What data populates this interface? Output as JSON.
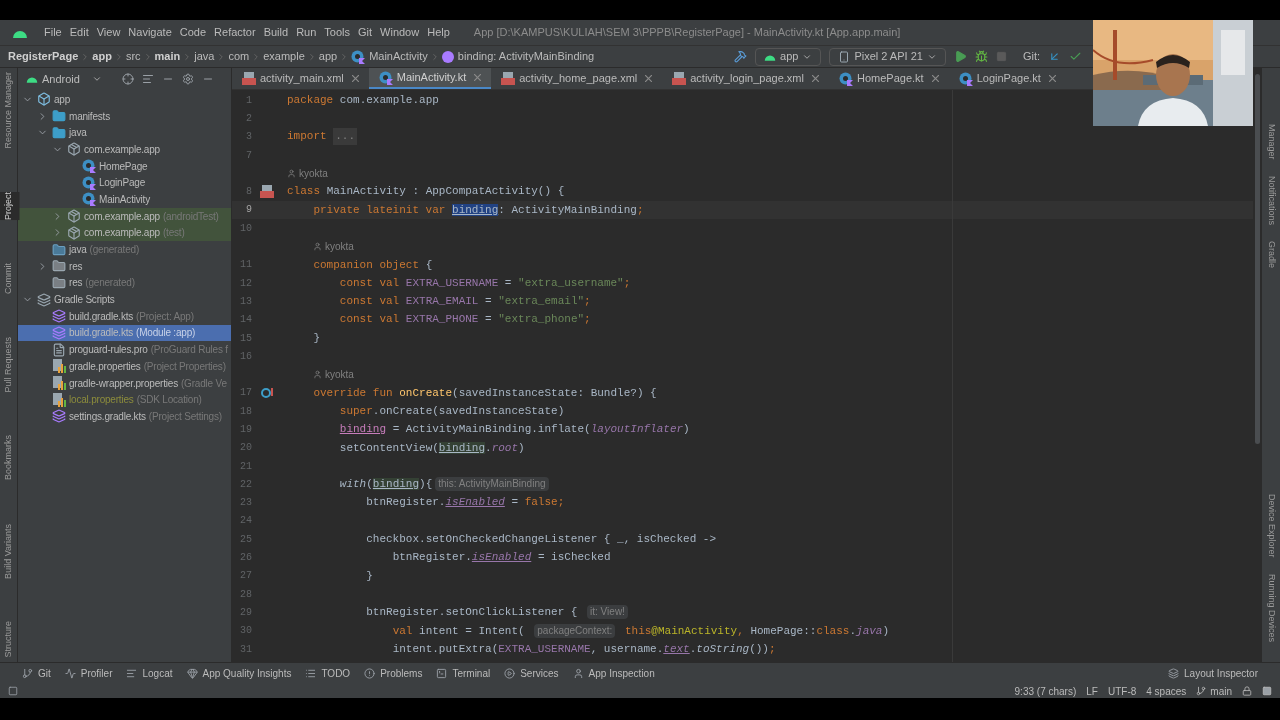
{
  "menu": [
    "File",
    "Edit",
    "View",
    "Navigate",
    "Code",
    "Refactor",
    "Build",
    "Run",
    "Tools",
    "Git",
    "Window",
    "Help"
  ],
  "window": {
    "title": "App [D:\\KAMPUS\\KULIAH\\SEM 3\\PPPB\\RegisterPage] - MainActivity.kt [App.app.main]"
  },
  "breadcrumbs": [
    {
      "text": "RegisterPage",
      "bold": true,
      "kind": "text"
    },
    {
      "text": "app",
      "bold": true,
      "kind": "text"
    },
    {
      "text": "src",
      "bold": false,
      "kind": "text"
    },
    {
      "text": "main",
      "bold": true,
      "kind": "text"
    },
    {
      "text": "java",
      "bold": false,
      "kind": "text"
    },
    {
      "text": "com",
      "bold": false,
      "kind": "text"
    },
    {
      "text": "example",
      "bold": false,
      "kind": "text"
    },
    {
      "text": "app",
      "bold": false,
      "kind": "text"
    },
    {
      "text": "MainActivity",
      "bold": false,
      "kind": "class"
    },
    {
      "text": "binding: ActivityMainBinding",
      "bold": false,
      "kind": "variable"
    }
  ],
  "toolbar": {
    "run_config": "app",
    "device": "Pixel 2 API 21",
    "git_label": "Git:"
  },
  "project_panel": {
    "view": "Android",
    "tree": [
      {
        "label": "app",
        "kind": "module",
        "expanded": true,
        "children": [
          {
            "label": "manifests",
            "kind": "folder",
            "expanded": false
          },
          {
            "label": "java",
            "kind": "folder",
            "expanded": true,
            "children": [
              {
                "label": "com.example.app",
                "kind": "package",
                "expanded": true,
                "children": [
                  {
                    "label": "HomePage",
                    "kind": "kotlin"
                  },
                  {
                    "label": "LoginPage",
                    "kind": "kotlin"
                  },
                  {
                    "label": "MainActivity",
                    "kind": "kotlin"
                  }
                ]
              },
              {
                "label": "com.example.app",
                "detail": "(androidTest)",
                "kind": "package",
                "expanded": false,
                "tinted": true
              },
              {
                "label": "com.example.app",
                "detail": "(test)",
                "kind": "package",
                "expanded": false,
                "tinted": true
              }
            ]
          },
          {
            "label": "java",
            "detail": "(generated)",
            "kind": "folder-generated"
          },
          {
            "label": "res",
            "kind": "res",
            "expanded": false
          },
          {
            "label": "res",
            "detail": "(generated)",
            "kind": "res"
          }
        ]
      },
      {
        "label": "Gradle Scripts",
        "kind": "gradle",
        "expanded": true,
        "children": [
          {
            "label": "build.gradle.kts",
            "detail": "(Project: App)",
            "kind": "gradle-file"
          },
          {
            "label": "build.gradle.kts",
            "detail": "(Module :app)",
            "kind": "gradle-file",
            "selected": true
          },
          {
            "label": "proguard-rules.pro",
            "detail": "(ProGuard Rules f",
            "kind": "text-file"
          },
          {
            "label": "gradle.properties",
            "detail": "(Project Properties)",
            "kind": "properties"
          },
          {
            "label": "gradle-wrapper.properties",
            "detail": "(Gradle Ve",
            "kind": "properties"
          },
          {
            "label": "local.properties",
            "detail": "(SDK Location)",
            "kind": "properties",
            "ignored": true
          },
          {
            "label": "settings.gradle.kts",
            "detail": "(Project Settings)",
            "kind": "gradle-file"
          }
        ]
      }
    ]
  },
  "left_tool_windows": [
    {
      "label": "Resource Manager",
      "selected": false
    },
    {
      "label": "Project",
      "selected": true
    },
    {
      "label": "Commit",
      "selected": false
    },
    {
      "label": "Pull Requests",
      "selected": false
    },
    {
      "label": "Bookmarks",
      "selected": false
    },
    {
      "label": "Build Variants",
      "selected": false
    },
    {
      "label": "Structure",
      "selected": false
    }
  ],
  "right_tool_windows": [
    "Manager",
    "Notifications",
    "Gradle",
    "Device Explorer",
    "Running Devices"
  ],
  "tabs": [
    {
      "label": "activity_main.xml",
      "kind": "xml",
      "selected": false
    },
    {
      "label": "MainActivity.kt",
      "kind": "kotlin",
      "selected": true
    },
    {
      "label": "activity_home_page.xml",
      "kind": "xml",
      "selected": false
    },
    {
      "label": "activity_login_page.xml",
      "kind": "xml",
      "selected": false
    },
    {
      "label": "HomePage.kt",
      "kind": "kotlin",
      "selected": false
    },
    {
      "label": "LoginPage.kt",
      "kind": "kotlin",
      "selected": false
    }
  ],
  "code": [
    {
      "number": "1",
      "tokens": [
        {
          "kind": "kw",
          "text": "package"
        },
        {
          "kind": "plain",
          "text": " com.example.app"
        }
      ]
    },
    {
      "number": "2"
    },
    {
      "number": "3",
      "tokens": [
        {
          "kind": "kw",
          "text": "import "
        },
        {
          "kind": "fold",
          "text": "..."
        }
      ]
    },
    {
      "number": "7"
    },
    {
      "author": "kyokta",
      "member": false
    },
    {
      "number": "8",
      "gutter": {
        "kind": "layout"
      },
      "tokens": [
        {
          "kind": "kw",
          "text": "class"
        },
        {
          "kind": "plain",
          "text": " MainActivity : AppCompatActivity() {"
        }
      ]
    },
    {
      "number": "9",
      "current": true,
      "tokens": [
        {
          "kind": "kw",
          "text": "    private lateinit var "
        },
        {
          "kind": "selected",
          "text": "binding"
        },
        {
          "kind": "plain",
          "text": ": ActivityMainBinding"
        },
        {
          "kind": "kw",
          "text": ";"
        }
      ]
    },
    {
      "number": "10"
    },
    {
      "author": "kyokta",
      "member": true
    },
    {
      "number": "11",
      "tokens": [
        {
          "kind": "kw",
          "text": "    companion object"
        },
        {
          "kind": "plain",
          "text": " {"
        }
      ]
    },
    {
      "number": "12",
      "tokens": [
        {
          "kind": "kw",
          "text": "        const val "
        },
        {
          "kind": "const",
          "text": "EXTRA_USERNAME"
        },
        {
          "kind": "plain",
          "text": " = "
        },
        {
          "kind": "str",
          "text": "\"extra_username\""
        },
        {
          "kind": "kw",
          "text": ";"
        }
      ]
    },
    {
      "number": "13",
      "tokens": [
        {
          "kind": "kw",
          "text": "        const val "
        },
        {
          "kind": "const",
          "text": "EXTRA_EMAIL"
        },
        {
          "kind": "plain",
          "text": " = "
        },
        {
          "kind": "str",
          "text": "\"extra_email\""
        },
        {
          "kind": "kw",
          "text": ";"
        }
      ]
    },
    {
      "number": "14",
      "tokens": [
        {
          "kind": "kw",
          "text": "        const val "
        },
        {
          "kind": "const",
          "text": "EXTRA_PHONE"
        },
        {
          "kind": "plain",
          "text": " = "
        },
        {
          "kind": "str",
          "text": "\"extra_phone\""
        },
        {
          "kind": "kw",
          "text": ";"
        }
      ]
    },
    {
      "number": "15",
      "tokens": [
        {
          "kind": "plain",
          "text": "    }"
        }
      ]
    },
    {
      "number": "16"
    },
    {
      "author": "kyokta",
      "member": true
    },
    {
      "number": "17",
      "gutter": {
        "kind": "override"
      },
      "tokens": [
        {
          "kind": "kw",
          "text": "    override fun "
        },
        {
          "kind": "fn",
          "text": "onCreate"
        },
        {
          "kind": "plain",
          "text": "(savedInstanceState: Bundle?) {"
        }
      ]
    },
    {
      "number": "18",
      "tokens": [
        {
          "kind": "kw",
          "text": "        super"
        },
        {
          "kind": "plain",
          "text": ".onCreate(savedInstanceState)"
        }
      ]
    },
    {
      "number": "19",
      "tokens": [
        {
          "kind": "field",
          "text": "        binding"
        },
        {
          "kind": "plain",
          "text": " = ActivityMainBinding.inflate("
        },
        {
          "kind": "italic",
          "text": "layoutInflater"
        },
        {
          "kind": "plain",
          "text": ")"
        }
      ]
    },
    {
      "number": "20",
      "tokens": [
        {
          "kind": "plain",
          "text": "        setContentView("
        },
        {
          "kind": "boxed",
          "text": "binding"
        },
        {
          "kind": "plain",
          "text": "."
        },
        {
          "kind": "italic",
          "text": "root"
        },
        {
          "kind": "plain",
          "text": ")"
        }
      ]
    },
    {
      "number": "21"
    },
    {
      "number": "22",
      "tokens": [
        {
          "kind": "fn-italic",
          "text": "        with"
        },
        {
          "kind": "plain",
          "text": "("
        },
        {
          "kind": "boxed",
          "text": "binding"
        },
        {
          "kind": "plain",
          "text": "){"
        },
        {
          "kind": "hint",
          "text": "this: ActivityMainBinding"
        }
      ]
    },
    {
      "number": "23",
      "tokens": [
        {
          "kind": "plain",
          "text": "            btnRegister."
        },
        {
          "kind": "ext",
          "text": "isEnabled"
        },
        {
          "kind": "plain",
          "text": " = "
        },
        {
          "kind": "kw",
          "text": "false;"
        }
      ]
    },
    {
      "number": "24"
    },
    {
      "number": "25",
      "tokens": [
        {
          "kind": "plain",
          "text": "            checkbox.setOnCheckedChangeListener { _, isChecked ->"
        }
      ]
    },
    {
      "number": "26",
      "tokens": [
        {
          "kind": "plain",
          "text": "                btnRegister."
        },
        {
          "kind": "ext",
          "text": "isEnabled"
        },
        {
          "kind": "plain",
          "text": " = isChecked"
        }
      ]
    },
    {
      "number": "27",
      "tokens": [
        {
          "kind": "plain",
          "text": "            }"
        }
      ]
    },
    {
      "number": "28"
    },
    {
      "number": "29",
      "tokens": [
        {
          "kind": "plain",
          "text": "            btnRegister.setOnClickListener { "
        },
        {
          "kind": "hint",
          "text": "it: View!"
        }
      ]
    },
    {
      "number": "30",
      "tokens": [
        {
          "kind": "kw",
          "text": "                val"
        },
        {
          "kind": "plain",
          "text": " intent = Intent( "
        },
        {
          "kind": "hint",
          "text": "packageContext:"
        },
        {
          "kind": "kw",
          "text": " this"
        },
        {
          "kind": "annotation",
          "text": "@MainActivity"
        },
        {
          "kind": "kw",
          "text": ","
        },
        {
          "kind": "plain",
          "text": " HomePage::"
        },
        {
          "kind": "kw",
          "text": "class"
        },
        {
          "kind": "plain",
          "text": "."
        },
        {
          "kind": "italic",
          "text": "java"
        },
        {
          "kind": "plain",
          "text": ")"
        }
      ]
    },
    {
      "number": "31",
      "tokens": [
        {
          "kind": "plain",
          "text": "                intent.putExtra("
        },
        {
          "kind": "const",
          "text": "EXTRA_USERNAME"
        },
        {
          "kind": "plain",
          "text": ", username."
        },
        {
          "kind": "ext",
          "text": "text"
        },
        {
          "kind": "plain",
          "text": "."
        },
        {
          "kind": "fn-italic",
          "text": "toString"
        },
        {
          "kind": "plain",
          "text": "())"
        },
        {
          "kind": "kw",
          "text": ";"
        }
      ]
    }
  ],
  "bottom_tools": [
    {
      "label": "Git",
      "kind": "git"
    },
    {
      "label": "Profiler",
      "kind": "profiler"
    },
    {
      "label": "Logcat",
      "kind": "logcat"
    },
    {
      "label": "App Quality Insights",
      "kind": "insights"
    },
    {
      "label": "TODO",
      "kind": "todo"
    },
    {
      "label": "Problems",
      "kind": "problems"
    },
    {
      "label": "Terminal",
      "kind": "terminal"
    },
    {
      "label": "Services",
      "kind": "services"
    },
    {
      "label": "App Inspection",
      "kind": "inspection"
    }
  ],
  "layout_inspector": "Layout Inspector",
  "status_bar": {
    "position": "9:33 (7 chars)",
    "line_separator": "LF",
    "encoding": "UTF-8",
    "indent": "4 spaces",
    "branch": "main"
  },
  "webcam": {
    "kind": "picture"
  }
}
